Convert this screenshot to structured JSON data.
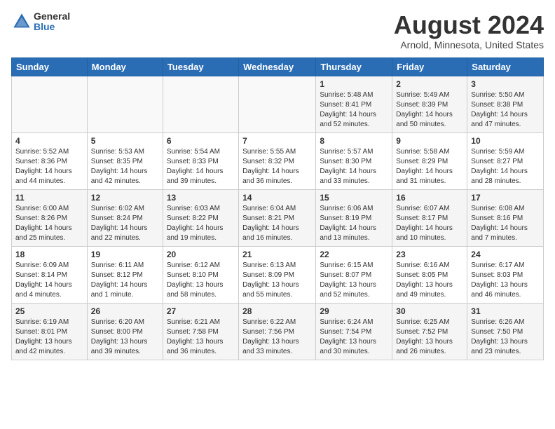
{
  "header": {
    "logo_general": "General",
    "logo_blue": "Blue",
    "title": "August 2024",
    "location": "Arnold, Minnesota, United States"
  },
  "weekdays": [
    "Sunday",
    "Monday",
    "Tuesday",
    "Wednesday",
    "Thursday",
    "Friday",
    "Saturday"
  ],
  "weeks": [
    [
      {
        "day": "",
        "info": ""
      },
      {
        "day": "",
        "info": ""
      },
      {
        "day": "",
        "info": ""
      },
      {
        "day": "",
        "info": ""
      },
      {
        "day": "1",
        "info": "Sunrise: 5:48 AM\nSunset: 8:41 PM\nDaylight: 14 hours\nand 52 minutes."
      },
      {
        "day": "2",
        "info": "Sunrise: 5:49 AM\nSunset: 8:39 PM\nDaylight: 14 hours\nand 50 minutes."
      },
      {
        "day": "3",
        "info": "Sunrise: 5:50 AM\nSunset: 8:38 PM\nDaylight: 14 hours\nand 47 minutes."
      }
    ],
    [
      {
        "day": "4",
        "info": "Sunrise: 5:52 AM\nSunset: 8:36 PM\nDaylight: 14 hours\nand 44 minutes."
      },
      {
        "day": "5",
        "info": "Sunrise: 5:53 AM\nSunset: 8:35 PM\nDaylight: 14 hours\nand 42 minutes."
      },
      {
        "day": "6",
        "info": "Sunrise: 5:54 AM\nSunset: 8:33 PM\nDaylight: 14 hours\nand 39 minutes."
      },
      {
        "day": "7",
        "info": "Sunrise: 5:55 AM\nSunset: 8:32 PM\nDaylight: 14 hours\nand 36 minutes."
      },
      {
        "day": "8",
        "info": "Sunrise: 5:57 AM\nSunset: 8:30 PM\nDaylight: 14 hours\nand 33 minutes."
      },
      {
        "day": "9",
        "info": "Sunrise: 5:58 AM\nSunset: 8:29 PM\nDaylight: 14 hours\nand 31 minutes."
      },
      {
        "day": "10",
        "info": "Sunrise: 5:59 AM\nSunset: 8:27 PM\nDaylight: 14 hours\nand 28 minutes."
      }
    ],
    [
      {
        "day": "11",
        "info": "Sunrise: 6:00 AM\nSunset: 8:26 PM\nDaylight: 14 hours\nand 25 minutes."
      },
      {
        "day": "12",
        "info": "Sunrise: 6:02 AM\nSunset: 8:24 PM\nDaylight: 14 hours\nand 22 minutes."
      },
      {
        "day": "13",
        "info": "Sunrise: 6:03 AM\nSunset: 8:22 PM\nDaylight: 14 hours\nand 19 minutes."
      },
      {
        "day": "14",
        "info": "Sunrise: 6:04 AM\nSunset: 8:21 PM\nDaylight: 14 hours\nand 16 minutes."
      },
      {
        "day": "15",
        "info": "Sunrise: 6:06 AM\nSunset: 8:19 PM\nDaylight: 14 hours\nand 13 minutes."
      },
      {
        "day": "16",
        "info": "Sunrise: 6:07 AM\nSunset: 8:17 PM\nDaylight: 14 hours\nand 10 minutes."
      },
      {
        "day": "17",
        "info": "Sunrise: 6:08 AM\nSunset: 8:16 PM\nDaylight: 14 hours\nand 7 minutes."
      }
    ],
    [
      {
        "day": "18",
        "info": "Sunrise: 6:09 AM\nSunset: 8:14 PM\nDaylight: 14 hours\nand 4 minutes."
      },
      {
        "day": "19",
        "info": "Sunrise: 6:11 AM\nSunset: 8:12 PM\nDaylight: 14 hours\nand 1 minute."
      },
      {
        "day": "20",
        "info": "Sunrise: 6:12 AM\nSunset: 8:10 PM\nDaylight: 13 hours\nand 58 minutes."
      },
      {
        "day": "21",
        "info": "Sunrise: 6:13 AM\nSunset: 8:09 PM\nDaylight: 13 hours\nand 55 minutes."
      },
      {
        "day": "22",
        "info": "Sunrise: 6:15 AM\nSunset: 8:07 PM\nDaylight: 13 hours\nand 52 minutes."
      },
      {
        "day": "23",
        "info": "Sunrise: 6:16 AM\nSunset: 8:05 PM\nDaylight: 13 hours\nand 49 minutes."
      },
      {
        "day": "24",
        "info": "Sunrise: 6:17 AM\nSunset: 8:03 PM\nDaylight: 13 hours\nand 46 minutes."
      }
    ],
    [
      {
        "day": "25",
        "info": "Sunrise: 6:19 AM\nSunset: 8:01 PM\nDaylight: 13 hours\nand 42 minutes."
      },
      {
        "day": "26",
        "info": "Sunrise: 6:20 AM\nSunset: 8:00 PM\nDaylight: 13 hours\nand 39 minutes."
      },
      {
        "day": "27",
        "info": "Sunrise: 6:21 AM\nSunset: 7:58 PM\nDaylight: 13 hours\nand 36 minutes."
      },
      {
        "day": "28",
        "info": "Sunrise: 6:22 AM\nSunset: 7:56 PM\nDaylight: 13 hours\nand 33 minutes."
      },
      {
        "day": "29",
        "info": "Sunrise: 6:24 AM\nSunset: 7:54 PM\nDaylight: 13 hours\nand 30 minutes."
      },
      {
        "day": "30",
        "info": "Sunrise: 6:25 AM\nSunset: 7:52 PM\nDaylight: 13 hours\nand 26 minutes."
      },
      {
        "day": "31",
        "info": "Sunrise: 6:26 AM\nSunset: 7:50 PM\nDaylight: 13 hours\nand 23 minutes."
      }
    ]
  ]
}
